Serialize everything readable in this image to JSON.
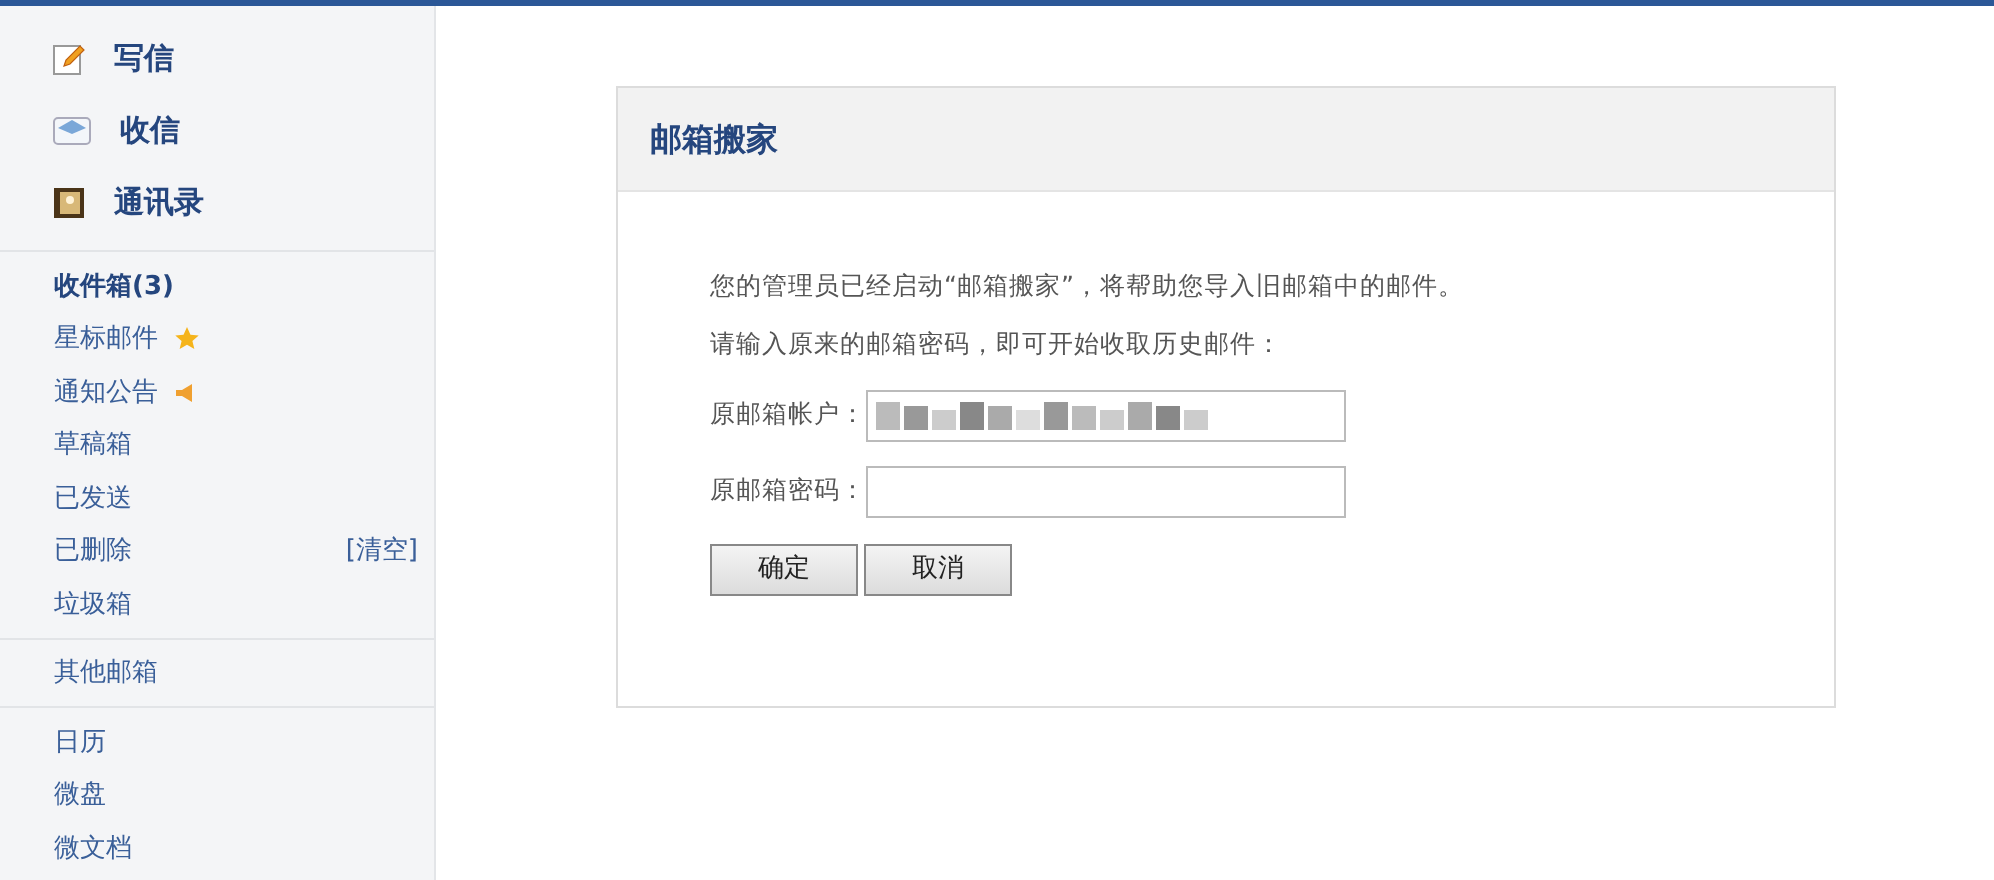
{
  "sidebar": {
    "main_actions": [
      {
        "kind": "compose",
        "label": "写信"
      },
      {
        "kind": "inbox",
        "label": "收信"
      },
      {
        "kind": "contacts",
        "label": "通讯录"
      }
    ],
    "folder_groups": [
      [
        {
          "label": "收件箱(3)",
          "selected": true
        },
        {
          "label": "星标邮件",
          "kind": "star"
        },
        {
          "label": "通知公告",
          "kind": "notice"
        },
        {
          "label": "草稿箱"
        },
        {
          "label": "已发送"
        },
        {
          "label": "已删除",
          "action": "[清空]"
        },
        {
          "label": "垃圾箱"
        }
      ],
      [
        {
          "label": "其他邮箱"
        }
      ],
      [
        {
          "label": "日历"
        },
        {
          "label": "微盘"
        },
        {
          "label": "微文档"
        }
      ]
    ]
  },
  "panel": {
    "title": "邮箱搬家",
    "lines": [
      "您的管理员已经启动“邮箱搬家”，将帮助您导入旧邮箱中的邮件。",
      "请输入原来的邮箱密码，即可开始收取历史邮件："
    ],
    "fields": [
      {
        "label": "原邮箱帐户：",
        "kind": "blurred"
      },
      {
        "label": "原邮箱密码：",
        "kind": "password"
      }
    ],
    "buttons": [
      "确定",
      "取消"
    ]
  }
}
